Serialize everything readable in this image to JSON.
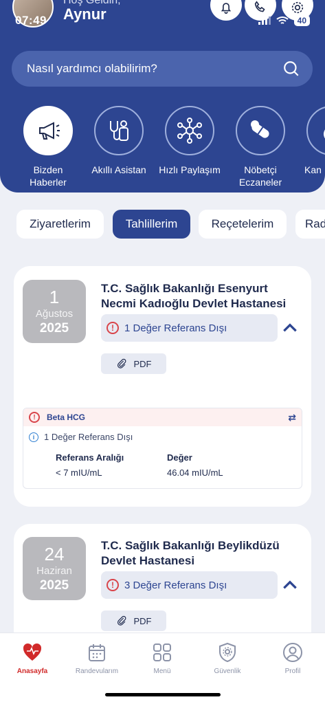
{
  "status": {
    "time": "07:49",
    "battery": "40"
  },
  "header": {
    "greeting": "Hoş Geldin,",
    "user_name": "Aynur"
  },
  "search": {
    "placeholder": "Nasıl yardımcı olabilirim?"
  },
  "quick_actions": [
    {
      "label": "Bizden Haberler",
      "icon": "megaphone-icon"
    },
    {
      "label": "Akıllı Asistan",
      "icon": "doctor-icon"
    },
    {
      "label": "Hızlı Paylaşım",
      "icon": "share-network-icon"
    },
    {
      "label": "Nöbetçi Eczaneler",
      "icon": "pills-icon"
    },
    {
      "label": "Kan",
      "icon": "blood-drop-icon"
    }
  ],
  "tabs": [
    {
      "label": "Ziyaretlerim"
    },
    {
      "label": "Tahlillerim",
      "active": true
    },
    {
      "label": "Reçetelerim"
    },
    {
      "label": "Rad"
    }
  ],
  "results": [
    {
      "day": "1",
      "month": "Ağustos",
      "year": "2025",
      "hospital_line1": "T.C. Sağlık Bakanlığı Esenyurt",
      "hospital_line2": "Necmi Kadıoğlu Devlet Hastanesi",
      "ref_status": "1 Değer Referans Dışı",
      "pdf_label": "PDF",
      "detail": {
        "test_name": "Beta HCG",
        "info": "1 Değer Referans Dışı",
        "range_header": "Referans Aralığı",
        "value_header": "Değer",
        "range_value": "< 7 mIU/mL",
        "value": "46.04 mIU/mL"
      }
    },
    {
      "day": "24",
      "month": "Haziran",
      "year": "2025",
      "hospital_line1": "T.C. Sağlık Bakanlığı Beylikdüzü",
      "hospital_line2": "Devlet Hastanesi",
      "ref_status": "3 Değer Referans Dışı",
      "pdf_label": "PDF"
    }
  ],
  "bottom_nav": [
    {
      "label": "Anasayfa",
      "active": true
    },
    {
      "label": "Randevularım"
    },
    {
      "label": "Menü"
    },
    {
      "label": "Güvenlik"
    },
    {
      "label": "Profil"
    }
  ],
  "colors": {
    "primary": "#2d4591",
    "alert": "#d9444a",
    "active_nav": "#d12a2a"
  }
}
